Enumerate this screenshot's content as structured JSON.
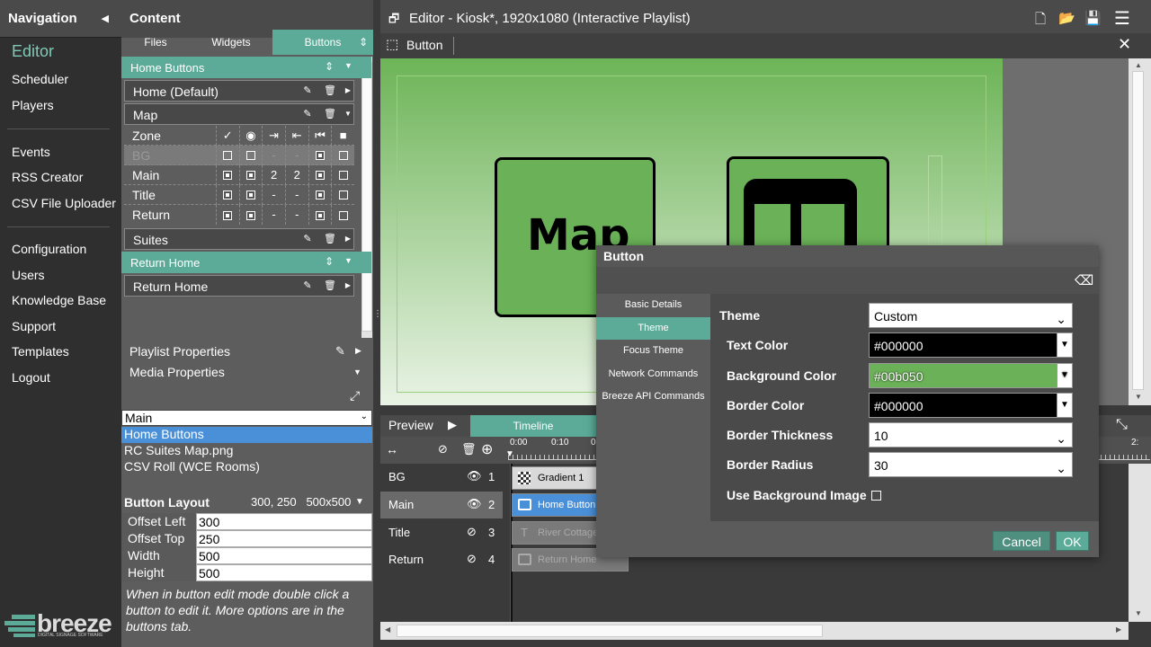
{
  "nav": {
    "header": "Navigation",
    "items": [
      "Editor",
      "Scheduler",
      "Players",
      "Events",
      "RSS Creator",
      "CSV File Uploader",
      "Configuration",
      "Users",
      "Knowledge Base",
      "Support",
      "Templates",
      "Logout"
    ],
    "logo_text": "breeze",
    "logo_sub": "DIGITAL SIGNAGE SOFTWARE"
  },
  "content": {
    "header": "Content",
    "tabs": [
      "Files",
      "Widgets",
      "Buttons"
    ],
    "groups": {
      "home_buttons": "Home Buttons",
      "return_home_group": "Return Home"
    },
    "buttons": {
      "home_default": "Home (Default)",
      "map": "Map",
      "suites": "Suites",
      "return_home": "Return Home"
    },
    "zones": {
      "header": "Zone",
      "rows": [
        {
          "name": "BG",
          "c3": "-",
          "c4": "-"
        },
        {
          "name": "Main",
          "c3": "2",
          "c4": "2"
        },
        {
          "name": "Title",
          "c3": "-",
          "c4": "-"
        },
        {
          "name": "Return",
          "c3": "-",
          "c4": "-"
        }
      ]
    },
    "playlist_properties": "Playlist Properties",
    "media_properties": "Media Properties",
    "zone_select": "Main",
    "media_list": [
      "Home Buttons",
      "RC Suites Map.png",
      "CSV Roll (WCE Rooms)"
    ],
    "button_layout": {
      "title": "Button Layout",
      "summary": "300, 250   500x500",
      "fields": [
        {
          "label": "Offset Left",
          "value": "300"
        },
        {
          "label": "Offset Top",
          "value": "250"
        },
        {
          "label": "Width",
          "value": "500"
        },
        {
          "label": "Height",
          "value": "500"
        }
      ]
    },
    "hint": "When in button edit mode double click a button to edit it. More options are in the buttons tab."
  },
  "editor": {
    "title": "Editor - Kiosk*, 1920x1080  (Interactive Playlist)",
    "sub_title": "Button",
    "stage_button_text": "Map"
  },
  "dialog": {
    "title": "Button",
    "sidebar": [
      "Basic Details",
      "Theme",
      "Focus Theme",
      "Network Commands",
      "Breeze API Commands"
    ],
    "fields": {
      "theme": {
        "label": "Theme",
        "value": "Custom"
      },
      "text_color": {
        "label": "Text Color",
        "value": "#000000",
        "swatch": "#000000"
      },
      "bg_color": {
        "label": "Background Color",
        "value": "#00b050",
        "swatch": "#6ab157"
      },
      "border_color": {
        "label": "Border Color",
        "value": "#000000",
        "swatch": "#000000"
      },
      "border_thickness": {
        "label": "Border Thickness",
        "value": "10"
      },
      "border_radius": {
        "label": "Border Radius",
        "value": "30"
      },
      "use_bg_image": {
        "label": "Use Background Image"
      }
    },
    "cancel": "Cancel",
    "ok": "OK"
  },
  "preview": {
    "label": "Preview",
    "timeline_tab": "Timeline",
    "times": [
      "0:00",
      "0:10",
      "0",
      "2:"
    ],
    "layers": [
      {
        "name": "BG",
        "num": "1"
      },
      {
        "name": "Main",
        "num": "2"
      },
      {
        "name": "Title",
        "num": "3"
      },
      {
        "name": "Return",
        "num": "4"
      }
    ],
    "clips": [
      "Gradient 1",
      "Home Button",
      "River Cottage",
      "Return Home"
    ]
  },
  "colors": {
    "accent": "#5bab98",
    "nav_active": "#7fcab5"
  }
}
